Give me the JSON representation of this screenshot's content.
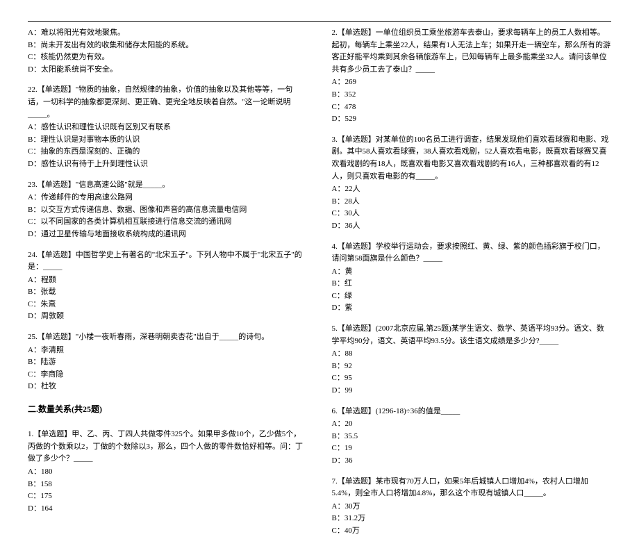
{
  "left": {
    "q21": {
      "optA": "A：难以将阳光有效地聚焦。",
      "optB": "B：尚未开发出有效的收集和储存太阳能的系统。",
      "optC": "C：核能仍然更为有效。",
      "optD": "D：太阳能系统尚不安全。"
    },
    "q22": {
      "text": "22.【单选题】\"物质的抽象，自然规律的抽象，价值的抽象以及其他等等，一句话，一切科学的抽象都更深刻、更正确、更完全地反映着自然。\"这一论断说明_____。",
      "optA": "A：感性认识和理性认识既有区别又有联系",
      "optB": "B：理性认识是对事物本质的认识",
      "optC": "C：抽象的东西是深刻的、正确的",
      "optD": "D：感性认识有待于上升到理性认识"
    },
    "q23": {
      "text": "23.【单选题】\"信息高速公路\"就是_____。",
      "optA": "A：传递邮件的专用高速公路网",
      "optB": "B：以交互方式传递信息、数据、图像和声音的高信息流量电信网",
      "optC": "C：以不同国家的各类计算机相互联接进行信息交流的通讯网",
      "optD": "D：通过卫星传输与地面接收系统构成的通讯网"
    },
    "q24": {
      "text": "24.【单选题】中国哲学史上有著名的\"北宋五子\"。下列人物中不属于\"北宋五子\"的是：_____",
      "optA": "A：程颢",
      "optB": "B：张载",
      "optC": "C：朱熹",
      "optD": "D：周敦颐"
    },
    "q25": {
      "text": "25.【单选题】\"小楼一夜听春雨，深巷明朝卖杏花\"出自于_____的诗句。",
      "optA": "A：李清照",
      "optB": "B：陆游",
      "optC": "C：李商隐",
      "optD": "D：杜牧"
    },
    "section2": "二.数量关系(共25题)",
    "s2q1": {
      "text": "1.【单选题】甲、乙、丙、丁四人共做零件325个。如果甲多做10个，乙少做5个，丙做的个数乘以2，丁做的个数除以3，那么，四个人做的零件数恰好相等。问：丁做了多少个？_____",
      "optA": "A：180",
      "optB": "B：158",
      "optC": "C：175",
      "optD": "D：164"
    }
  },
  "right": {
    "q2": {
      "text": "2.【单选题】一单位组织员工乘坐旅游车去泰山，要求每辆车上的员工人数相等。起初，每辆车上乘坐22人，结果有1人无法上车；如果开走一辆空车，那么所有的游客正好能平均乘到其余各辆旅游车上，已知每辆车上最多能乘坐32人。请问该单位共有多少员工去了泰山？_____",
      "optA": "A：269",
      "optB": "B：352",
      "optC": "C：478",
      "optD": "D：529"
    },
    "q3": {
      "text": "3.【单选题】对某单位的100名员工进行调查，结果发现他们喜欢看球赛和电影、戏剧。其中58人喜欢看球赛，38人喜欢看戏剧，52人喜欢看电影，既喜欢看球赛又喜欢看戏剧的有18人，既喜欢看电影又喜欢看戏剧的有16人，三种都喜欢看的有12人，则只喜欢看电影的有_____。",
      "optA": "A：22人",
      "optB": "B：28人",
      "optC": "C：30人",
      "optD": "D：36人"
    },
    "q4": {
      "text": "4.【单选题】学校举行运动会，要求按照红、黄、绿、紫的颜色插彩旗于校门口，请问第58面旗是什么颜色？_____",
      "optA": "A：黄",
      "optB": "B：红",
      "optC": "C：绿",
      "optD": "D：紫"
    },
    "q5": {
      "text": "5.【单选题】(2007北京应届,第25题)某学生语文、数学、英语平均93分。语文、数学平均90分，语文、英语平均93.5分。该生语文成绩是多少分?_____",
      "optA": "A：88",
      "optB": "B：92",
      "optC": "C：95",
      "optD": "D：99"
    },
    "q6": {
      "text": "6.【单选题】(1296-18)÷36的值是_____",
      "optA": "A：20",
      "optB": "B：35.5",
      "optC": "C：19",
      "optD": "D：36"
    },
    "q7": {
      "text": "7.【单选题】某市现有70万人口，如果5年后城镇人口增加4%，农村人口增加5.4%，则全市人口将增加4.8%，那么这个市现有城镇人口_____。",
      "optA": "A：30万",
      "optB": "B：31.2万",
      "optC": "C：40万"
    }
  }
}
